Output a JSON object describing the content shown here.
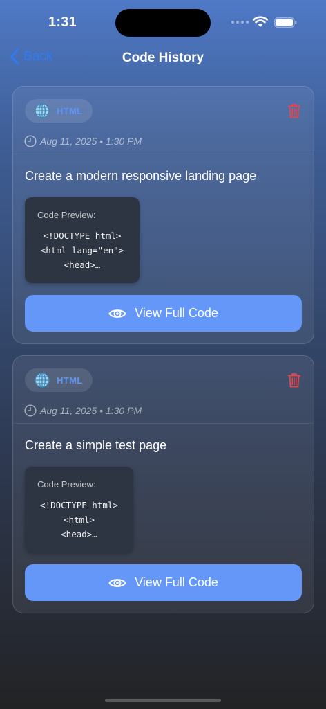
{
  "status_bar": {
    "time": "1:31"
  },
  "nav": {
    "back_label": "Back",
    "title": "Code History"
  },
  "colors": {
    "accent": "#6497f7",
    "back": "#2f7bf6",
    "delete": "#e5484d",
    "badge_text": "#5f95f4"
  },
  "cards": [
    {
      "language": "HTML",
      "language_icon": "globe-icon",
      "date": "Aug 11, 2025 • 1:30 PM",
      "prompt": "Create a modern responsive landing page",
      "preview_label": "Code Preview:",
      "preview_lines": [
        "<!DOCTYPE html>",
        "<html lang=\"en\">",
        "<head>…"
      ],
      "button_label": "View Full Code"
    },
    {
      "language": "HTML",
      "language_icon": "globe-icon",
      "date": "Aug 11, 2025 • 1:30 PM",
      "prompt": "Create a simple test page",
      "preview_label": "Code Preview:",
      "preview_lines": [
        "<!DOCTYPE html>",
        "<html>",
        "<head>…"
      ],
      "button_label": "View Full Code"
    }
  ]
}
